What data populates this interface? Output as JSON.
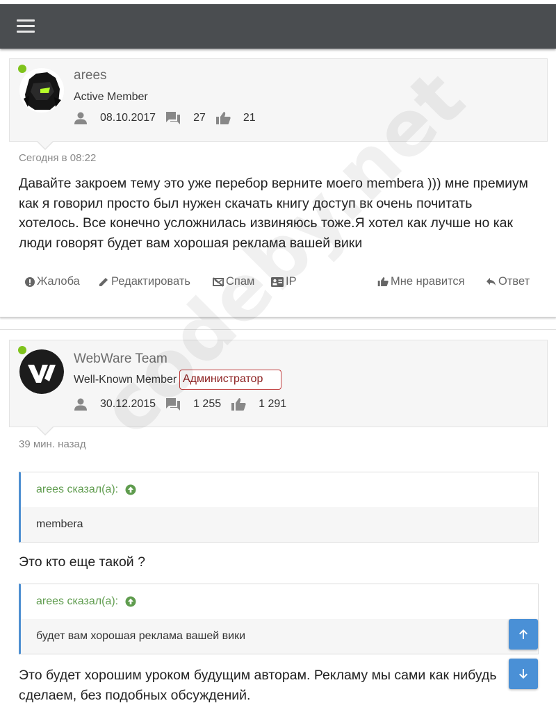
{
  "header": {
    "menu_icon": "hamburger-menu-icon"
  },
  "posts": [
    {
      "username": "arees",
      "user_title": "Active Member",
      "stats": {
        "joined": "08.10.2017",
        "messages": "27",
        "likes": "21"
      },
      "date": "Сегодня в 08:22",
      "message": "Давайте закроем тему это уже перебор верните моего membera ))) мне премиум как я говорил просто был нужен скачать книгу доступ вк очень почитать хотелось. Все конечно усложнилась извиняюсь тоже.Я хотел как лучше но как люди говорят будет вам хорошая реклама вашей вики",
      "actions": {
        "report": "Жалоба",
        "edit": "Редактировать",
        "spam": "Спам",
        "ip": "IP",
        "like": "Мне нравится",
        "reply": "Ответ"
      }
    },
    {
      "username": "WebWare Team",
      "user_title": "Well-Known Member",
      "badge": "Администратор",
      "stats": {
        "joined": "30.12.2015",
        "messages": "1 255",
        "likes": "1 291"
      },
      "date": "39 мин. назад",
      "quotes": [
        {
          "author": "arees сказал(а):",
          "text": "membera"
        },
        {
          "author": "arees сказал(а):",
          "text": "будет вам хорошая реклама вашей вики"
        }
      ],
      "text1": "Это кто еще такой ?",
      "text2": "Это будет хорошим уроком будущим авторам. Рекламу мы сами как нибудь сделаем, без подобных обсуждений."
    }
  ],
  "watermark": "codeby.net",
  "colors": {
    "accent": "#4a90d6",
    "online": "#7fc31c",
    "quote_author": "#5f9c4e",
    "admin_badge": "#c13c3c",
    "topbar": "#4a4d50"
  }
}
